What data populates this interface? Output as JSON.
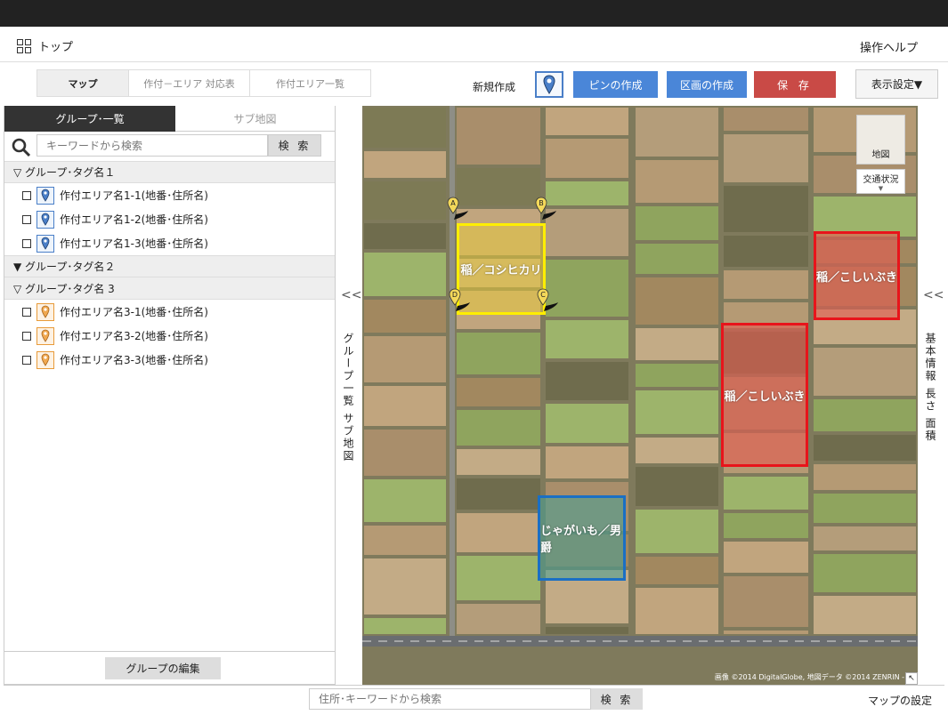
{
  "header": {
    "home_label": "トップ",
    "help_label": "操作ヘルプ"
  },
  "toolbar": {
    "tabs": [
      "マップ",
      "作付－エリア 対応表",
      "作付エリア一覧"
    ],
    "new_label": "新規作成",
    "pin_create": "ピンの作成",
    "polygon_create": "区画の作成",
    "save": "保 存",
    "display_settings": "表示設定▼"
  },
  "sidebar": {
    "tab_groups": "グループ･一覧",
    "tab_submap": "サブ地図",
    "search_placeholder": "キーワードから検索",
    "search_button": "検 索",
    "groups": [
      {
        "title": "▽ グループ･タグ名１",
        "items": [
          "作付エリア名1-1(地番･住所名)",
          "作付エリア名1-2(地番･住所名)",
          "作付エリア名1-3(地番･住所名)"
        ]
      },
      {
        "title": "▼ グループ･タグ名２",
        "items": []
      },
      {
        "title": "▽ グループ･タグ名 3",
        "items": [
          "作付エリア名3-1(地番･住所名)",
          "作付エリア名3-2(地番･住所名)",
          "作付エリア名3-3(地番･住所名)"
        ]
      }
    ],
    "edit_group": "グループの編集"
  },
  "collapse_left": {
    "chevron": "<<",
    "label": "グループ一覧 サブ地図"
  },
  "collapse_right": {
    "chevron": "<<",
    "label": "基本情報 長さ 面積"
  },
  "map": {
    "layer_button": "地図",
    "traffic_button": "交通状況",
    "fields": [
      {
        "label": "稲／コシヒカリ",
        "color": "#ffee00"
      },
      {
        "label": "稲／こしいぶき",
        "color": "#e8141b"
      },
      {
        "label": "稲／こしいぶき",
        "color": "#e8141b"
      },
      {
        "label": "じゃがいも／男爵",
        "color": "#1a6fc4"
      }
    ],
    "markers": [
      "A",
      "B",
      "C",
      "D"
    ],
    "attribution": "画像 ©2014 DigitalGlobe, 地図データ ©2014 ZENRIN -"
  },
  "bottom": {
    "search_placeholder": "住所･キーワードから検索",
    "search_button": "検 索",
    "map_settings": "マップの設定"
  }
}
